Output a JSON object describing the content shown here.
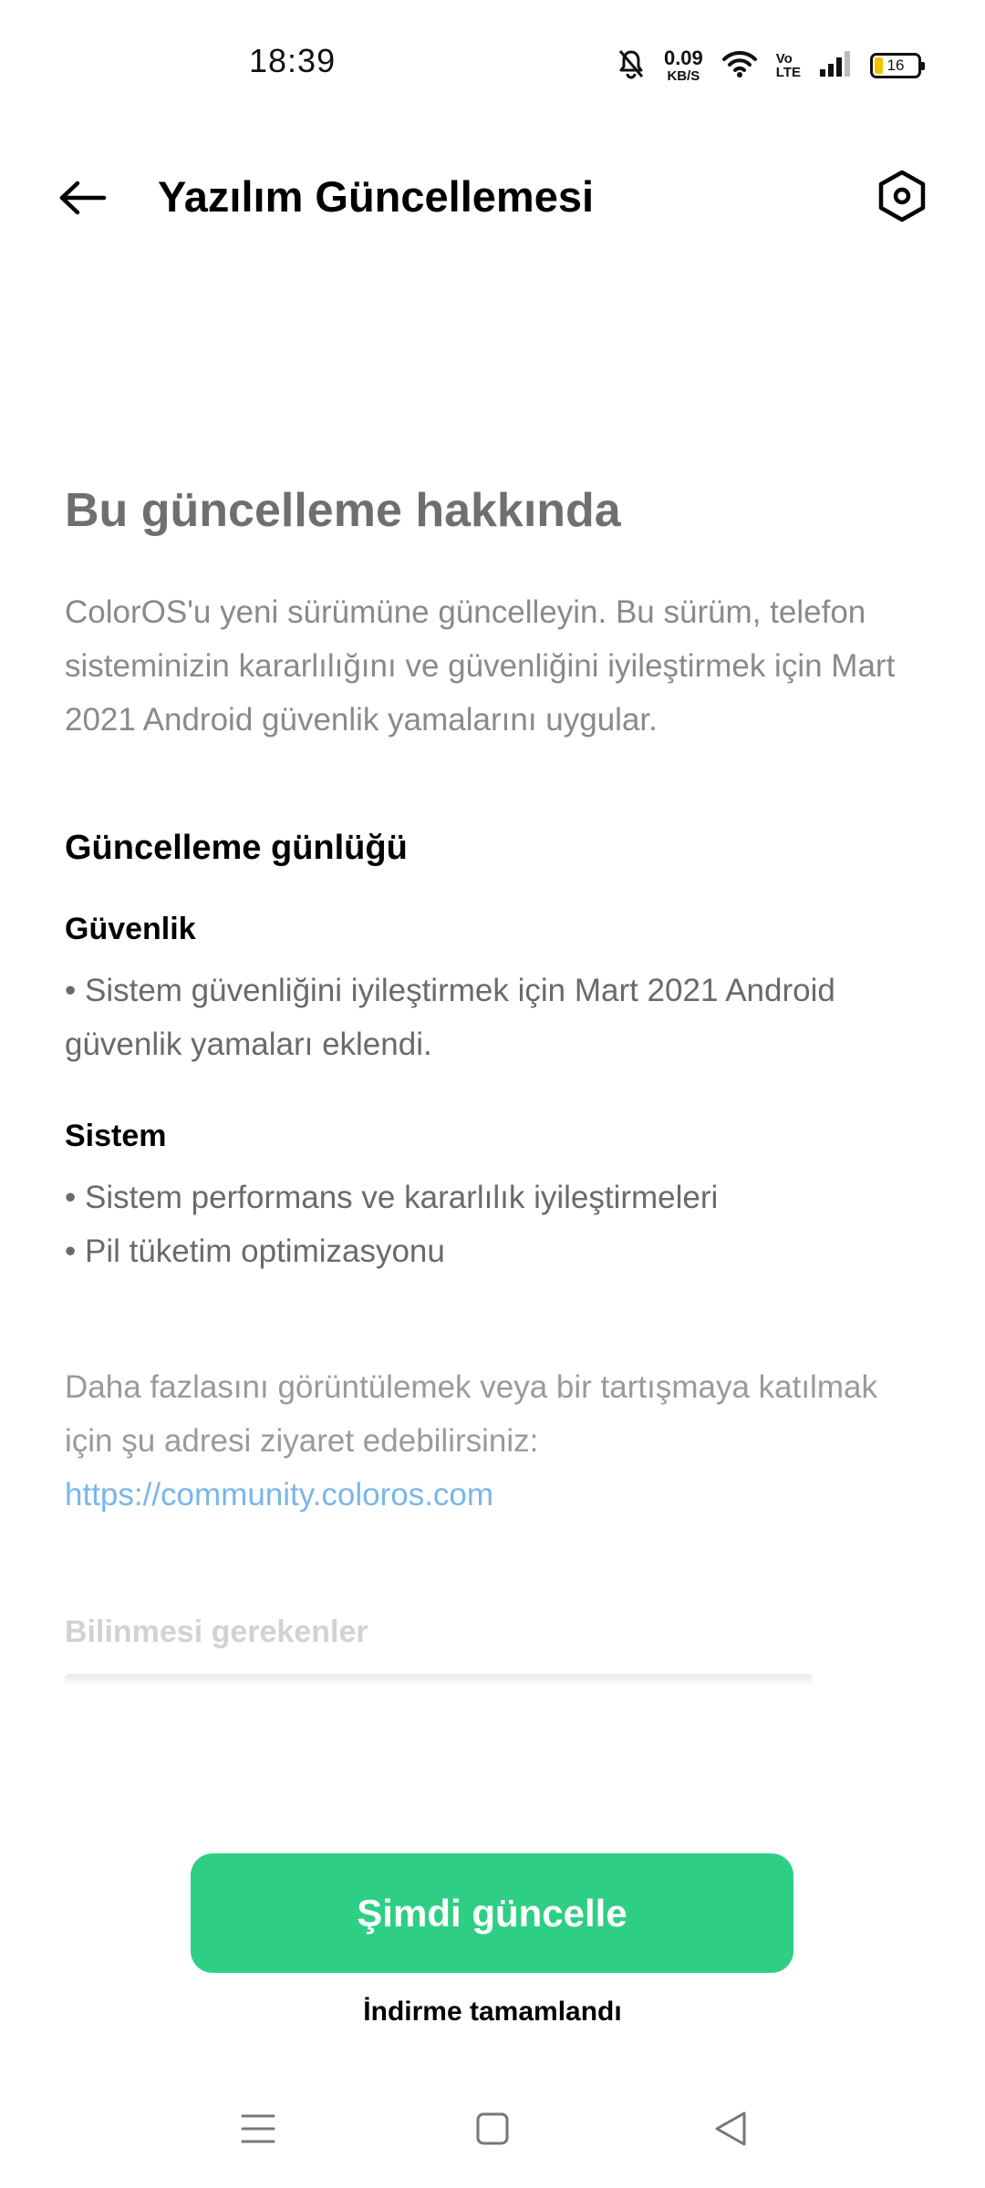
{
  "status_bar": {
    "time": "18:39",
    "net_speed_value": "0.09",
    "net_speed_unit": "KB/S",
    "volte_top": "Vo",
    "volte_bottom": "LTE",
    "battery_level": "16",
    "icons": [
      "bell-muted-icon",
      "wifi-icon",
      "signal-icon",
      "battery-icon"
    ]
  },
  "app_bar": {
    "title": "Yazılım Güncellemesi",
    "back_icon": "arrow-left-icon",
    "settings_icon": "hexagon-settings-icon"
  },
  "content": {
    "about_title": "Bu güncelleme hakkında",
    "about_desc": "ColorOS'u yeni sürümüne güncelleyin. Bu sürüm, telefon sisteminizin kararlılığını ve güvenliğini iyileştirmek için Mart 2021 Android güvenlik yamalarını uygular.",
    "log_title": "Güncelleme günlüğü",
    "sections": [
      {
        "title": "Güvenlik",
        "items": [
          "• Sistem güvenliğini iyileştirmek için Mart 2021 Android güvenlik yamaları eklendi."
        ]
      },
      {
        "title": "Sistem",
        "items": [
          "• Sistem performans ve kararlılık iyileştirmeleri",
          "• Pil tüketim optimizasyonu"
        ]
      }
    ],
    "more_info_text": "Daha fazlasını görüntülemek veya bir tartışmaya katılmak için şu adresi ziyaret edebilirsiniz:",
    "more_info_link": "https://community.coloros.com",
    "notes_title": "Bilinmesi gerekenler"
  },
  "actions": {
    "update_button": "Şimdi güncelle",
    "download_status": "İndirme tamamlandı"
  },
  "colors": {
    "accent": "#2ecf84",
    "link": "#79b6ea"
  },
  "nav_bar": {
    "icons": [
      "menu-icon",
      "home-square-icon",
      "back-triangle-icon"
    ]
  }
}
